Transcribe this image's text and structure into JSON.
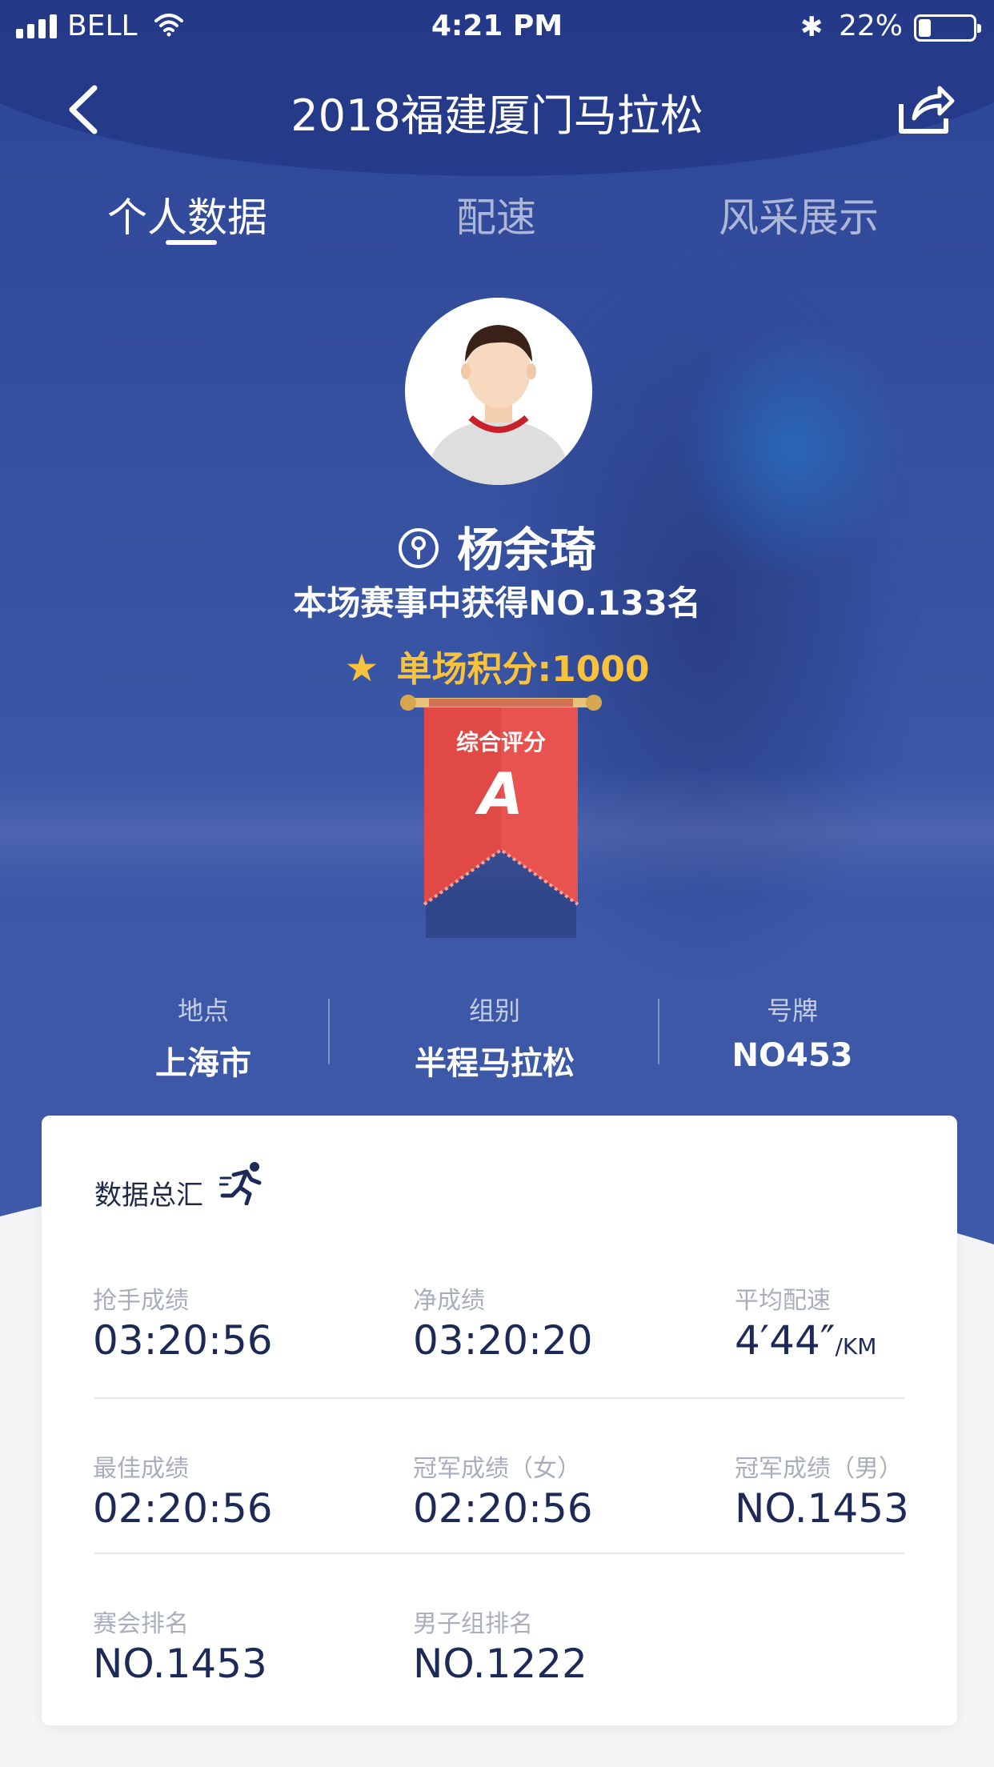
{
  "status": {
    "carrier": "BELL",
    "time": "4:21 PM",
    "battery": "22%",
    "battery_level": 0.22
  },
  "nav": {
    "title": "2018福建厦门马拉松"
  },
  "tabs": [
    "个人数据",
    "配速",
    "风采展示"
  ],
  "profile": {
    "name": "杨余琦",
    "rank_line": "本场赛事中获得NO.133名",
    "score_line": "单场积分:1000",
    "badge_label": "综合评分",
    "badge_grade": "A"
  },
  "meta": [
    {
      "label": "地点",
      "value": "上海市"
    },
    {
      "label": "组别",
      "value": "半程马拉松"
    },
    {
      "label": "号牌",
      "value": "NO453"
    }
  ],
  "summary": {
    "title": "数据总汇",
    "stats": [
      {
        "label": "抢手成绩",
        "value": "03:20:56"
      },
      {
        "label": "净成绩",
        "value": "03:20:20"
      },
      {
        "label": "平均配速",
        "value": "4′44″",
        "unit": "/KM"
      },
      {
        "label": "最佳成绩",
        "value": "02:20:56"
      },
      {
        "label": "冠军成绩（女）",
        "value": "02:20:56"
      },
      {
        "label": "冠军成绩（男）",
        "value": "NO.1453"
      },
      {
        "label": "赛会排名",
        "value": "NO.1453"
      },
      {
        "label": "男子组排名",
        "value": "NO.1222"
      }
    ]
  },
  "colors": {
    "hero": "#3a56a6",
    "gold": "#f8c23c",
    "ribbon": "#e8524f",
    "text_dark": "#1d2a58"
  },
  "icons": [
    "back-icon",
    "share-icon",
    "location-pin-icon",
    "star-icon",
    "runner-icon"
  ]
}
